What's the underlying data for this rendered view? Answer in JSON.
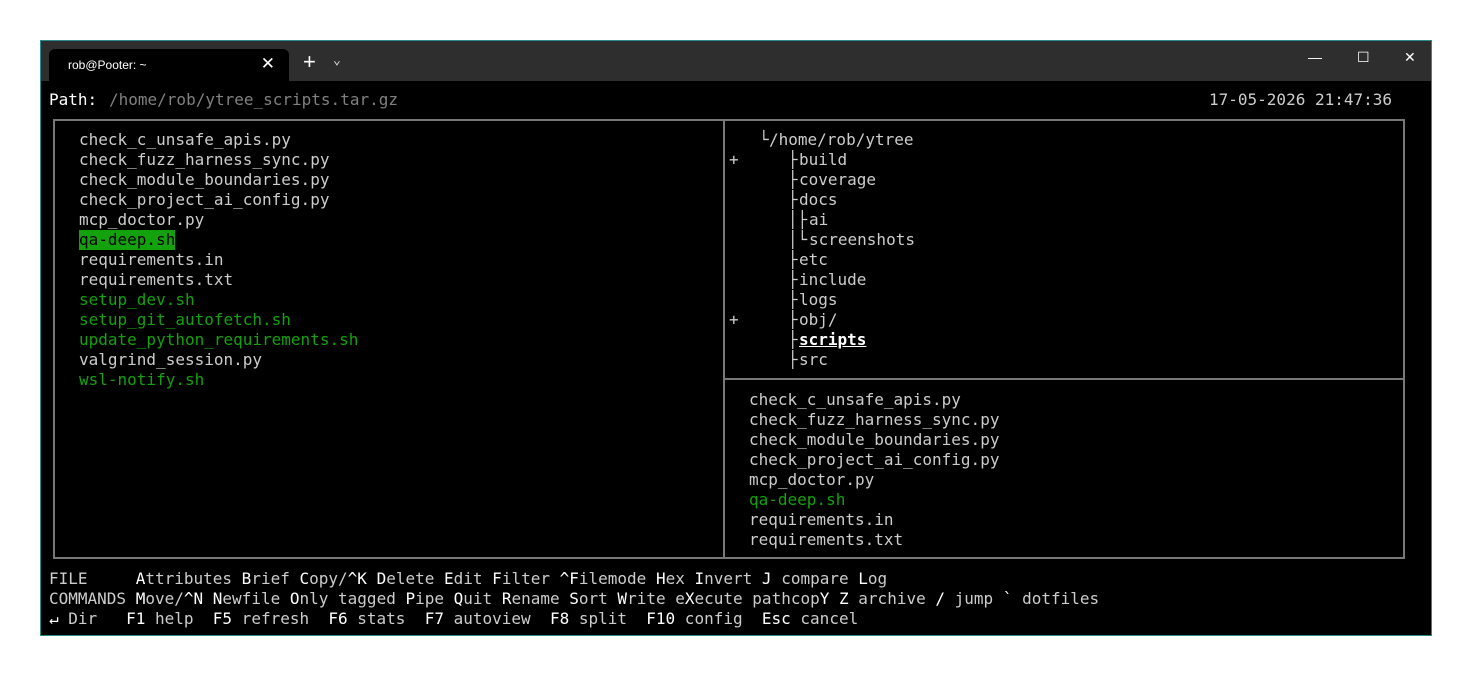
{
  "window": {
    "tab_title": "rob@Pooter: ~",
    "close_tab": "✕",
    "new_tab": "+",
    "tab_dropdown": "⌄",
    "minimize": "—",
    "maximize": "☐",
    "close": "✕"
  },
  "header": {
    "path_label": "Path:",
    "path_value": "/home/rob/ytree_scripts.tar.gz",
    "datetime": "17-05-2026 21:47:36"
  },
  "left_files": [
    {
      "name": "check_c_unsafe_apis.py",
      "type": "normal"
    },
    {
      "name": "check_fuzz_harness_sync.py",
      "type": "normal"
    },
    {
      "name": "check_module_boundaries.py",
      "type": "normal"
    },
    {
      "name": "check_project_ai_config.py",
      "type": "normal"
    },
    {
      "name": "mcp_doctor.py",
      "type": "normal"
    },
    {
      "name": "qa-deep.sh",
      "type": "selected"
    },
    {
      "name": "requirements.in",
      "type": "normal"
    },
    {
      "name": "requirements.txt",
      "type": "normal"
    },
    {
      "name": "setup_dev.sh",
      "type": "exec"
    },
    {
      "name": "setup_git_autofetch.sh",
      "type": "exec"
    },
    {
      "name": "update_python_requirements.sh",
      "type": "exec"
    },
    {
      "name": "valgrind_session.py",
      "type": "normal"
    },
    {
      "name": "wsl-notify.sh",
      "type": "exec"
    }
  ],
  "tree": [
    {
      "marker": "",
      "prefix": "└",
      "name": "/home/rob/ytree",
      "current": false
    },
    {
      "marker": "+",
      "prefix": "   ├",
      "name": "build",
      "current": false
    },
    {
      "marker": "",
      "prefix": "   ├",
      "name": "coverage",
      "current": false
    },
    {
      "marker": "",
      "prefix": "   ├",
      "name": "docs",
      "current": false
    },
    {
      "marker": "",
      "prefix": "   │├",
      "name": "ai",
      "current": false
    },
    {
      "marker": "",
      "prefix": "   │└",
      "name": "screenshots",
      "current": false
    },
    {
      "marker": "",
      "prefix": "   ├",
      "name": "etc",
      "current": false
    },
    {
      "marker": "",
      "prefix": "   ├",
      "name": "include",
      "current": false
    },
    {
      "marker": "",
      "prefix": "   ├",
      "name": "logs",
      "current": false
    },
    {
      "marker": "+",
      "prefix": "   ├",
      "name": "obj/",
      "current": false
    },
    {
      "marker": "",
      "prefix": "   ├",
      "name": "scripts",
      "current": true
    },
    {
      "marker": "",
      "prefix": "   ├",
      "name": "src",
      "current": false
    }
  ],
  "right_files": [
    {
      "name": "check_c_unsafe_apis.py",
      "type": "normal"
    },
    {
      "name": "check_fuzz_harness_sync.py",
      "type": "normal"
    },
    {
      "name": "check_module_boundaries.py",
      "type": "normal"
    },
    {
      "name": "check_project_ai_config.py",
      "type": "normal"
    },
    {
      "name": "mcp_doctor.py",
      "type": "normal"
    },
    {
      "name": "qa-deep.sh",
      "type": "exec"
    },
    {
      "name": "requirements.in",
      "type": "normal"
    },
    {
      "name": "requirements.txt",
      "type": "normal"
    }
  ],
  "footer": {
    "row1": [
      {
        "t": "FILE     ",
        "k": false
      },
      {
        "t": "A",
        "k": true
      },
      {
        "t": "ttributes ",
        "k": false
      },
      {
        "t": "B",
        "k": true
      },
      {
        "t": "rief ",
        "k": false
      },
      {
        "t": "C",
        "k": true
      },
      {
        "t": "opy/",
        "k": false
      },
      {
        "t": "^K",
        "k": true
      },
      {
        "t": " ",
        "k": false
      },
      {
        "t": "D",
        "k": true
      },
      {
        "t": "elete ",
        "k": false
      },
      {
        "t": "E",
        "k": true
      },
      {
        "t": "dit ",
        "k": false
      },
      {
        "t": "F",
        "k": true
      },
      {
        "t": "ilter ",
        "k": false
      },
      {
        "t": "^F",
        "k": true
      },
      {
        "t": "ilemode ",
        "k": false
      },
      {
        "t": "H",
        "k": true
      },
      {
        "t": "ex ",
        "k": false
      },
      {
        "t": "I",
        "k": true
      },
      {
        "t": "nvert ",
        "k": false
      },
      {
        "t": "J",
        "k": true
      },
      {
        "t": " compare ",
        "k": false
      },
      {
        "t": "L",
        "k": true
      },
      {
        "t": "og",
        "k": false
      }
    ],
    "row2": [
      {
        "t": "COMMANDS ",
        "k": false
      },
      {
        "t": "M",
        "k": true
      },
      {
        "t": "ove/",
        "k": false
      },
      {
        "t": "^N",
        "k": true
      },
      {
        "t": " ",
        "k": false
      },
      {
        "t": "N",
        "k": true
      },
      {
        "t": "ewfile ",
        "k": false
      },
      {
        "t": "O",
        "k": true
      },
      {
        "t": "nly tagged ",
        "k": false
      },
      {
        "t": "P",
        "k": true
      },
      {
        "t": "ipe ",
        "k": false
      },
      {
        "t": "Q",
        "k": true
      },
      {
        "t": "uit ",
        "k": false
      },
      {
        "t": "R",
        "k": true
      },
      {
        "t": "ename ",
        "k": false
      },
      {
        "t": "S",
        "k": true
      },
      {
        "t": "ort ",
        "k": false
      },
      {
        "t": "W",
        "k": true
      },
      {
        "t": "rite e",
        "k": false
      },
      {
        "t": "X",
        "k": true
      },
      {
        "t": "ecute pathcop",
        "k": false
      },
      {
        "t": "Y",
        "k": true
      },
      {
        "t": " ",
        "k": false
      },
      {
        "t": "Z",
        "k": true
      },
      {
        "t": " archive ",
        "k": false
      },
      {
        "t": "/",
        "k": true
      },
      {
        "t": " jump ",
        "k": false
      },
      {
        "t": "`",
        "k": true
      },
      {
        "t": " dotfiles",
        "k": false
      }
    ],
    "row3": [
      {
        "t": "↵",
        "k": true
      },
      {
        "t": " Dir   ",
        "k": false
      },
      {
        "t": "F1",
        "k": true
      },
      {
        "t": " help  ",
        "k": false
      },
      {
        "t": "F5",
        "k": true
      },
      {
        "t": " refresh  ",
        "k": false
      },
      {
        "t": "F6",
        "k": true
      },
      {
        "t": " stats  ",
        "k": false
      },
      {
        "t": "F7",
        "k": true
      },
      {
        "t": " autoview  ",
        "k": false
      },
      {
        "t": "F8",
        "k": true
      },
      {
        "t": " split  ",
        "k": false
      },
      {
        "t": "F10",
        "k": true
      },
      {
        "t": " config  ",
        "k": false
      },
      {
        "t": "Esc",
        "k": true
      },
      {
        "t": " cancel",
        "k": false
      }
    ]
  },
  "colors": {
    "exec_green": "#13a10e",
    "panel_border": "#777777",
    "window_border": "#2b8a8a"
  }
}
